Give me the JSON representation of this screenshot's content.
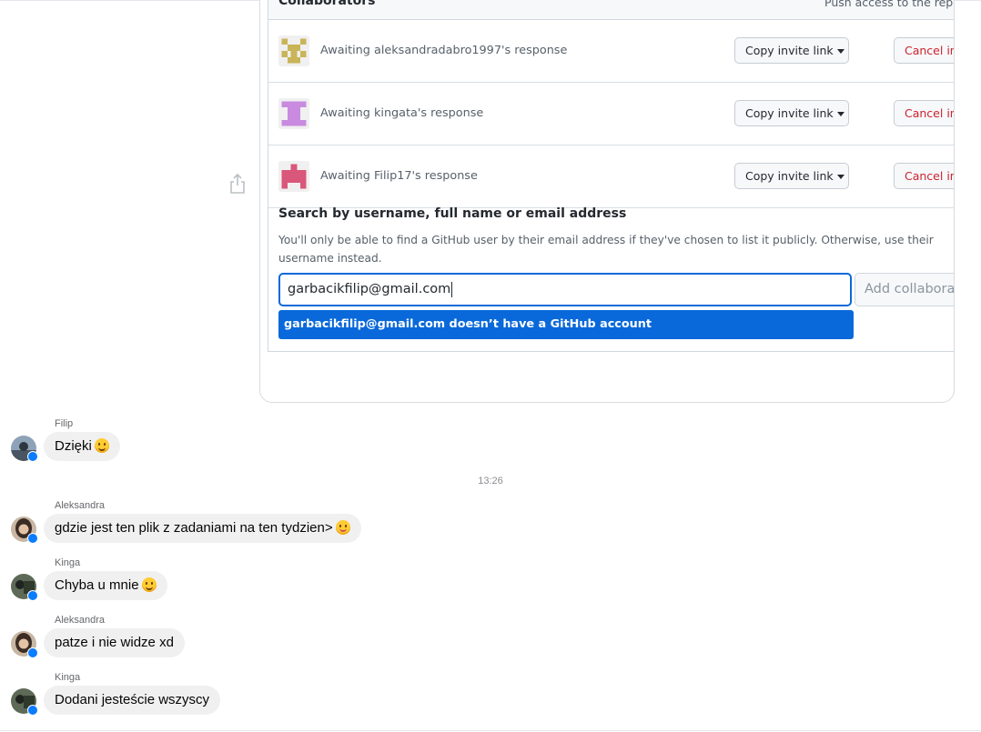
{
  "github": {
    "section_title": "Collaborators",
    "section_right": "Push access to the repo",
    "pending": [
      {
        "text": "Awaiting aleksandradabro1997's response",
        "copy_label": "Copy invite link",
        "cancel_label": "Cancel invite"
      },
      {
        "text": "Awaiting kingata's response",
        "copy_label": "Copy invite link",
        "cancel_label": "Cancel invite"
      },
      {
        "text": "Awaiting Filip17's response",
        "copy_label": "Copy invite link",
        "cancel_label": "Cancel invite"
      }
    ],
    "search": {
      "title": "Search by username, full name or email address",
      "help": "You'll only be able to find a GitHub user by their email address if they've chosen to list it publicly. Otherwise, use their username instead.",
      "value": "garbacikfilip@gmail.com",
      "add_label": "Add collaborator",
      "suggestion": "garbacikfilip@gmail.com doesn’t have a GitHub account"
    }
  },
  "chat": {
    "timestamp": "13:26",
    "messages": [
      {
        "sender": "Filip",
        "text": "Dzięki",
        "emoji": "slightly-smiling-face"
      },
      {
        "sender": "Aleksandra",
        "text": "gdzie jest ten plik z zadaniami na ten tydzien>",
        "emoji": "winking-face-with-tongue"
      },
      {
        "sender": "Kinga",
        "text": "Chyba u mnie",
        "emoji": "grinning-face"
      },
      {
        "sender": "Aleksandra",
        "text": "patze i nie widze xd",
        "emoji": ""
      },
      {
        "sender": "Kinga",
        "text": "Dodani jesteście wszyscy",
        "emoji": ""
      }
    ]
  },
  "colors": {
    "link_blue": "#0969da",
    "danger": "#cf222e",
    "bubble": "#f0f0f0",
    "messenger_badge": "#0a7cff"
  }
}
